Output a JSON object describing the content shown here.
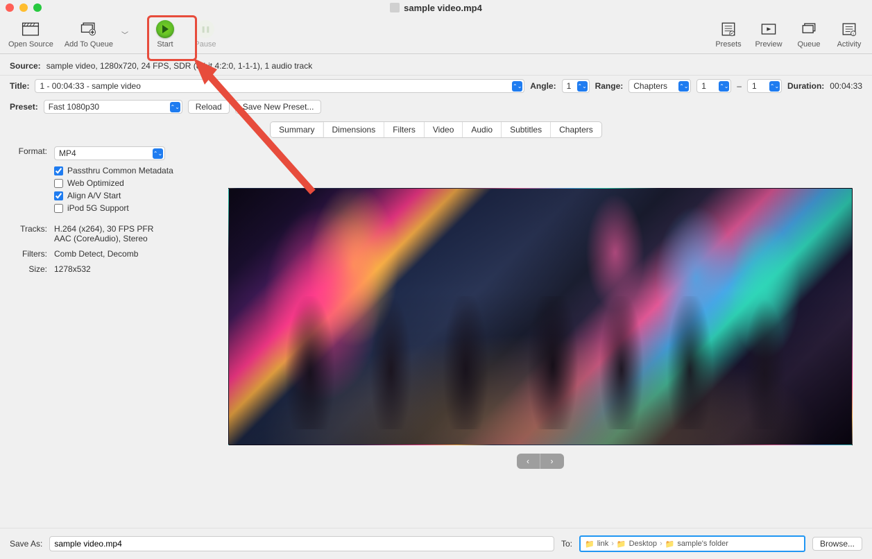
{
  "window": {
    "title": "sample video.mp4"
  },
  "toolbar": {
    "open_source": "Open Source",
    "add_to_queue": "Add To Queue",
    "start": "Start",
    "pause": "Pause",
    "presets": "Presets",
    "preview": "Preview",
    "queue": "Queue",
    "activity": "Activity"
  },
  "source": {
    "label": "Source:",
    "value": "sample video, 1280x720, 24 FPS, SDR (8-bit 4:2:0, 1-1-1), 1 audio track"
  },
  "title_row": {
    "label": "Title:",
    "value": "1 - 00:04:33 - sample video",
    "angle_label": "Angle:",
    "angle_value": "1",
    "range_label": "Range:",
    "range_value": "Chapters",
    "range_from": "1",
    "range_sep": "–",
    "range_to": "1",
    "duration_label": "Duration:",
    "duration_value": "00:04:33"
  },
  "preset": {
    "label": "Preset:",
    "value": "Fast 1080p30",
    "reload": "Reload",
    "save_new": "Save New Preset..."
  },
  "tabs": [
    "Summary",
    "Dimensions",
    "Filters",
    "Video",
    "Audio",
    "Subtitles",
    "Chapters"
  ],
  "summary": {
    "format_label": "Format:",
    "format_value": "MP4",
    "checks": {
      "passthru": {
        "label": "Passthru Common Metadata",
        "checked": true
      },
      "web": {
        "label": "Web Optimized",
        "checked": false
      },
      "align": {
        "label": "Align A/V Start",
        "checked": true
      },
      "ipod": {
        "label": "iPod 5G Support",
        "checked": false
      }
    },
    "tracks_label": "Tracks:",
    "tracks_value": "H.264 (x264), 30 FPS PFR\nAAC (CoreAudio), Stereo",
    "filters_label": "Filters:",
    "filters_value": "Comb Detect, Decomb",
    "size_label": "Size:",
    "size_value": "1278x532"
  },
  "save": {
    "label": "Save As:",
    "value": "sample video.mp4",
    "to_label": "To:",
    "path": [
      "link",
      "Desktop",
      "sample's folder"
    ],
    "browse": "Browse..."
  }
}
